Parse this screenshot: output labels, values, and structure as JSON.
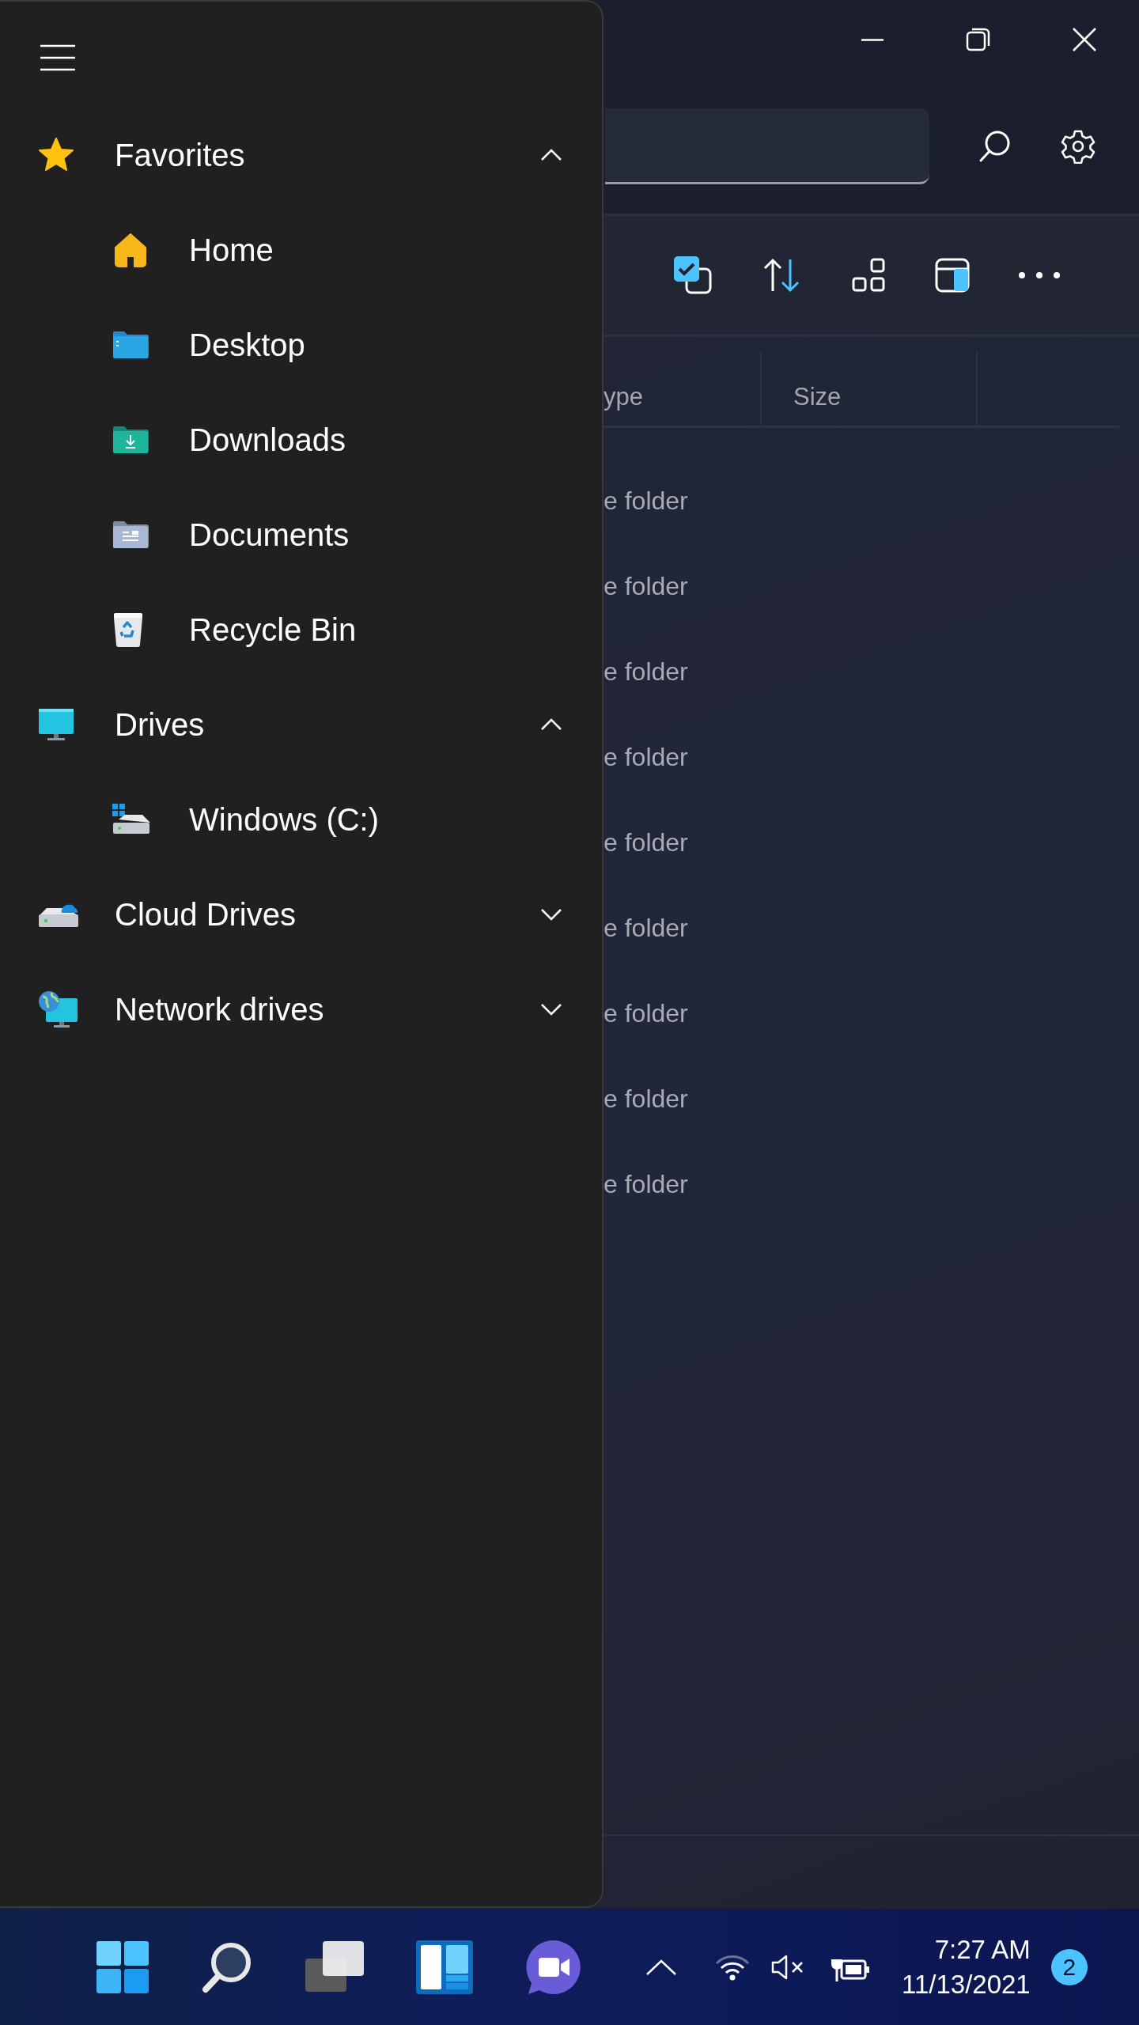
{
  "sidebar": {
    "sections": [
      {
        "label": "Favorites",
        "kind": "star",
        "expanded": true,
        "children": [
          {
            "label": "Home",
            "kind": "home"
          },
          {
            "label": "Desktop",
            "kind": "desktop-folder"
          },
          {
            "label": "Downloads",
            "kind": "downloads-folder"
          },
          {
            "label": "Documents",
            "kind": "documents-folder"
          },
          {
            "label": "Recycle Bin",
            "kind": "recycle-bin"
          }
        ]
      },
      {
        "label": "Drives",
        "kind": "monitor",
        "expanded": true,
        "children": [
          {
            "label": "Windows (C:)",
            "kind": "system-drive"
          }
        ]
      },
      {
        "label": "Cloud Drives",
        "kind": "cloud-drive",
        "expanded": false
      },
      {
        "label": "Network drives",
        "kind": "network",
        "expanded": false
      }
    ]
  },
  "file_list": {
    "columns": [
      {
        "label": "ype"
      },
      {
        "label": "Size"
      }
    ],
    "rows": [
      {
        "type": "e folder"
      },
      {
        "type": "e folder"
      },
      {
        "type": "e folder"
      },
      {
        "type": "e folder"
      },
      {
        "type": "e folder"
      },
      {
        "type": "e folder"
      },
      {
        "type": "e folder"
      },
      {
        "type": "e folder"
      },
      {
        "type": "e folder"
      }
    ]
  },
  "taskbar": {
    "time": "7:27 AM",
    "date": "11/13/2021",
    "notification_count": "2"
  }
}
